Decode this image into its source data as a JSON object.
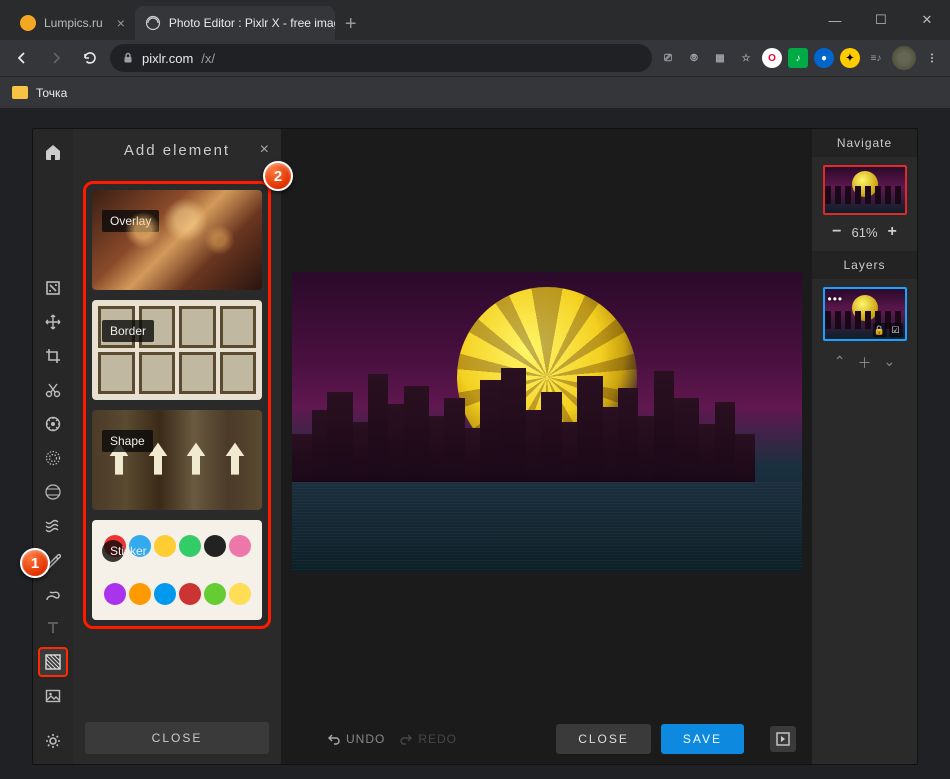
{
  "browser": {
    "tab1_title": "Lumpics.ru",
    "tab2_title": "Photo Editor : Pixlr X - free image",
    "url_host": "pixlr.com",
    "url_path": "/x/",
    "bookmark1": "Точка"
  },
  "panel": {
    "title": "Add element",
    "categories": [
      {
        "label": "Overlay"
      },
      {
        "label": "Border"
      },
      {
        "label": "Shape"
      },
      {
        "label": "Sticker"
      }
    ],
    "close": "CLOSE"
  },
  "canvas_actions": {
    "undo": "UNDO",
    "redo": "REDO",
    "close": "CLOSE",
    "save": "SAVE"
  },
  "right": {
    "navigate": "Navigate",
    "layers": "Layers",
    "zoom_minus": "−",
    "zoom_value": "61%",
    "zoom_plus": "+",
    "layer_menu": "•••"
  },
  "badges": {
    "one": "1",
    "two": "2"
  }
}
